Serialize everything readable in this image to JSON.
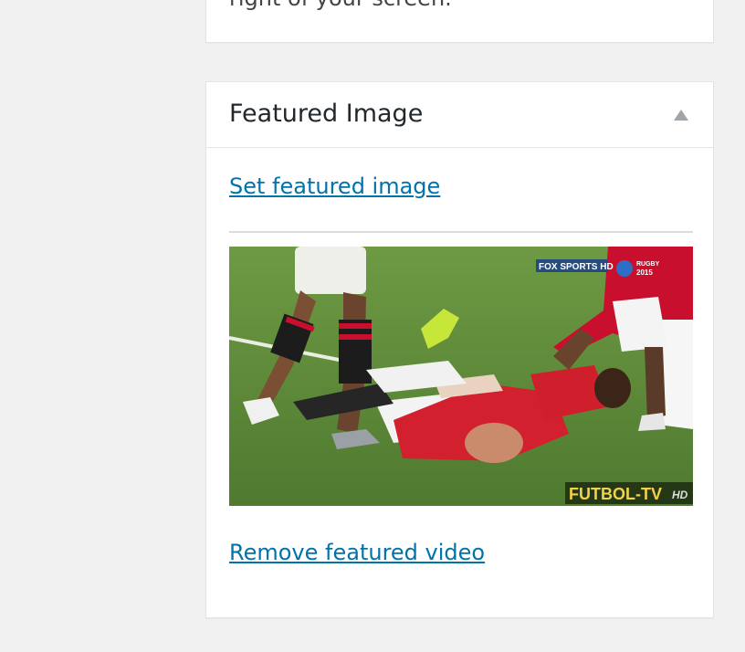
{
  "top_box": {
    "cut_text": "right of your screen."
  },
  "featured_box": {
    "title": "Featured Image",
    "set_link": "Set featured image",
    "remove_link": "Remove featured video",
    "thumbnail": {
      "broadcaster_logo": "FOX SPORTS HD",
      "event_logo_line1": "RUGBY",
      "event_logo_line2": "2015",
      "watermark": "FUTBOL-TV",
      "watermark_suffix": "HD"
    }
  }
}
